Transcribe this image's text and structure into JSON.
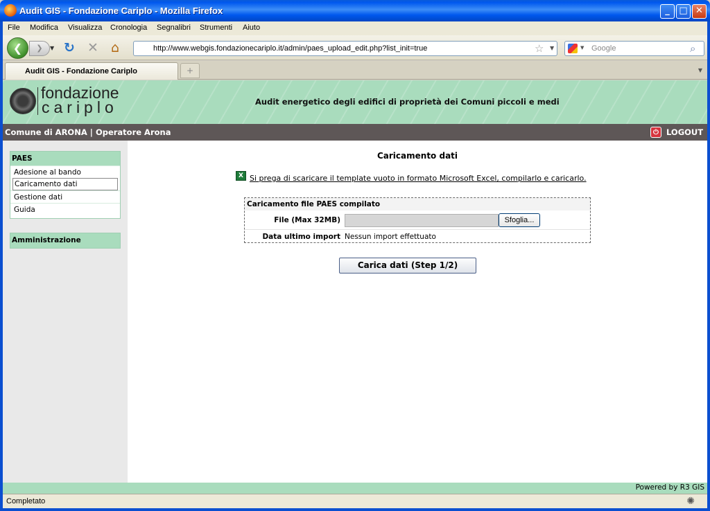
{
  "window": {
    "title": "Audit GIS - Fondazione Cariplo - Mozilla Firefox",
    "buttons": {
      "minimize": "_",
      "maximize": "□",
      "close": "✕"
    }
  },
  "menu": [
    "File",
    "Modifica",
    "Visualizza",
    "Cronologia",
    "Segnalibri",
    "Strumenti",
    "Aiuto"
  ],
  "nav": {
    "url": "http://www.webgis.fondazionecariplo.it/admin/paes_upload_edit.php?list_init=true",
    "search_placeholder": "Google"
  },
  "tabs": [
    {
      "label": "Audit GIS - Fondazione Cariplo"
    }
  ],
  "banner": {
    "logo_line1": "fondazione",
    "logo_line2": "cariplo",
    "title": "Audit energetico degli edifici di proprietà dei Comuni piccoli e medi"
  },
  "userbar": {
    "user": "Comune di ARONA | Operatore Arona",
    "logout": "LOGOUT"
  },
  "sidebar": {
    "section_title": "PAES",
    "items": [
      "Adesione al bando",
      "Caricamento dati",
      "Gestione dati",
      "Guida"
    ],
    "active_item": "Caricamento dati",
    "admin": "Amministrazione"
  },
  "content": {
    "heading": "Caricamento dati",
    "template_link": " Si prega di scaricare il template vuoto in formato Microsoft Excel, compilarlo e caricarlo.",
    "fieldset_legend": "Caricamento file PAES compilato",
    "file_label": "File (Max 32MB)",
    "browse_label": "Sfoglia...",
    "last_import_label": "Data ultimo import",
    "last_import_value": "Nessun import effettuato",
    "submit_label": "Carica dati (Step 1/2)"
  },
  "footer": {
    "powered": "Powered by R3 GIS"
  },
  "status": {
    "text": "Completato"
  },
  "icons": {
    "app": "firefox-icon",
    "back": "back-arrow-icon",
    "forward": "forward-arrow-icon",
    "reload": "reload-icon",
    "stop": "stop-icon",
    "home": "home-icon",
    "bookmark": "star-icon",
    "search": "magnifier-icon",
    "excel": "excel-icon",
    "logout": "logout-icon"
  },
  "colors": {
    "banner": "#a9dcbd",
    "userbar": "#5e5757",
    "sidebar": "#e9e9e9",
    "titlebar": "#0058ee"
  }
}
